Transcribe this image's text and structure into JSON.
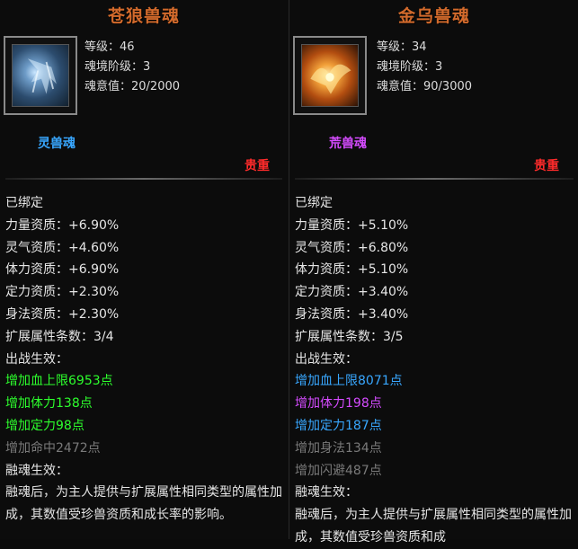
{
  "left": {
    "title": "苍狼兽魂",
    "icon": "wolf-spirit-icon",
    "stats": [
      "等级：46",
      "魂境阶级：3",
      "魂意值：20/2000"
    ],
    "soul_type": "灵兽魂",
    "precious": "贵重",
    "bound": "已绑定",
    "attributes": [
      "力量资质：+6.90%",
      "灵气资质：+4.60%",
      "体力资质：+6.90%",
      "定力资质：+2.30%",
      "身法资质：+2.30%",
      "扩展属性条数：3/4"
    ],
    "battle_label": "出战生效：",
    "battle_effects": [
      {
        "text": "增加血上限6953点",
        "color": "#2dff2d"
      },
      {
        "text": "增加体力138点",
        "color": "#2dff2d"
      },
      {
        "text": "增加定力98点",
        "color": "#2dff2d"
      },
      {
        "text": "增加命中2472点",
        "color": "#7a7a7a"
      }
    ],
    "fusion_label": "融魂生效：",
    "fusion_desc": "融魂后，为主人提供与扩展属性相同类型的属性加成，其数值受珍兽资质和成长率的影响。"
  },
  "right": {
    "title": "金乌兽魂",
    "icon": "golden-crow-icon",
    "stats": [
      "等级：34",
      "魂境阶级：3",
      "魂意值：90/3000"
    ],
    "soul_type": "荒兽魂",
    "precious": "贵重",
    "bound": "已绑定",
    "attributes": [
      "力量资质：+5.10%",
      "灵气资质：+6.80%",
      "体力资质：+5.10%",
      "定力资质：+3.40%",
      "身法资质：+3.40%",
      "扩展属性条数：3/5"
    ],
    "battle_label": "出战生效：",
    "battle_effects": [
      {
        "text": "增加血上限8071点",
        "color": "#38a7ff"
      },
      {
        "text": "增加体力198点",
        "color": "#d54bff"
      },
      {
        "text": "增加定力187点",
        "color": "#38a7ff"
      },
      {
        "text": "增加身法134点",
        "color": "#7a7a7a"
      },
      {
        "text": "增加闪避487点",
        "color": "#7a7a7a"
      }
    ],
    "fusion_label": "融魂生效：",
    "fusion_desc": "融魂后，为主人提供与扩展属性相同类型的属性加成，其数值受珍兽资质和成"
  },
  "colors": {
    "title": "#d26a2c",
    "precious": "#ff2b2b",
    "lingshou": "#38a7ff",
    "huangshou": "#d54bff"
  }
}
